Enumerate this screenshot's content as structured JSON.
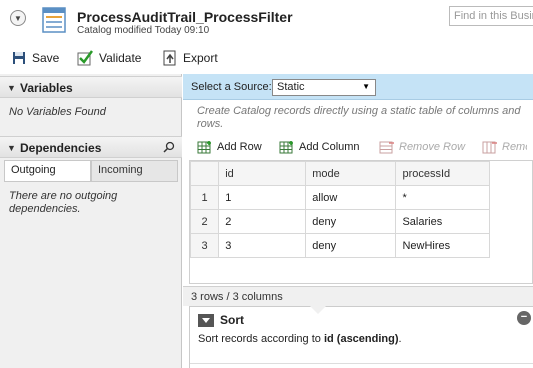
{
  "header": {
    "title": "ProcessAuditTrail_ProcessFilter",
    "subtitle": "Catalog modified Today 09:10",
    "search_placeholder": "Find in this Business"
  },
  "toolbar": {
    "save_label": "Save",
    "validate_label": "Validate",
    "export_label": "Export"
  },
  "left": {
    "variables_title": "Variables",
    "variables_empty": "No Variables Found",
    "dependencies_title": "Dependencies",
    "tab_outgoing": "Outgoing",
    "tab_incoming": "Incoming",
    "outgoing_empty_line1": "There are no outgoing",
    "outgoing_empty_line2": "dependencies."
  },
  "main": {
    "source_label": "Select a Source:",
    "source_value": "Static",
    "description": "Create Catalog records directly using a static table of columns and rows.",
    "add_row": "Add Row",
    "add_column": "Add Column",
    "remove_row": "Remove Row",
    "remove_column": "Remove Column",
    "columns": [
      "id",
      "mode",
      "processId"
    ],
    "rows": [
      {
        "num": "1",
        "id": "1",
        "mode": "allow",
        "processId": "*"
      },
      {
        "num": "2",
        "id": "2",
        "mode": "deny",
        "processId": "Salaries"
      },
      {
        "num": "3",
        "id": "3",
        "mode": "deny",
        "processId": "NewHires"
      }
    ],
    "status": "3 rows / 3 columns",
    "sort_title": "Sort",
    "sort_prefix": "Sort records according to ",
    "sort_field": "id (ascending)",
    "sort_suffix": "."
  }
}
